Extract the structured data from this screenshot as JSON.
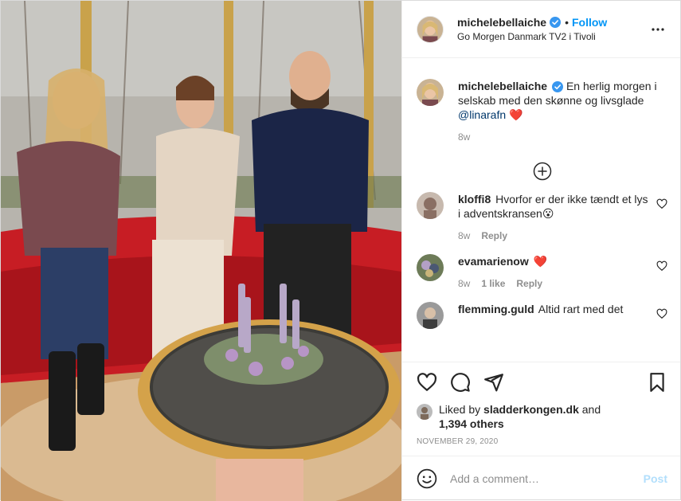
{
  "photo": {
    "alt": "",
    "colors": {
      "sofa": "#c71d24",
      "table_rim": "#d4a24a",
      "floor": "#c99b68"
    }
  },
  "header": {
    "username": "michelebellaiche",
    "separator": "•",
    "follow_label": "Follow",
    "location": "Go Morgen Danmark TV2 i Tivoli"
  },
  "caption": {
    "username": "michelebellaiche",
    "text": " En herlig morgen i selskab med den skønne og livsglade ",
    "mention": "@linarafn",
    "emoji": "❤️",
    "time": "8w"
  },
  "comments": [
    {
      "username": "kloffi8",
      "text": " Hvorfor er der ikke tændt et lys i adventskransen",
      "emoji": "😮",
      "time": "8w",
      "reply": "Reply",
      "likes": ""
    },
    {
      "username": "evamarienow",
      "text": " ",
      "emoji": "❤️",
      "time": "8w",
      "likes": "1 like",
      "reply": "Reply"
    },
    {
      "username": "flemming.guld",
      "text": " Altid rart med det",
      "emoji": "",
      "time": "",
      "reply": "",
      "likes": ""
    }
  ],
  "likes": {
    "prefix": "Liked by ",
    "user": "sladderkongen.dk",
    "middle": " and",
    "count": "1,394 others"
  },
  "date": "November 29, 2020",
  "add_comment": {
    "placeholder": "Add a comment…",
    "post_label": "Post"
  },
  "icons": {
    "verified": "verified-badge-icon",
    "more": "more-options-icon",
    "load_more": "plus-circle-icon",
    "like": "heart-icon",
    "comment": "comment-icon",
    "share": "paper-plane-icon",
    "save": "bookmark-icon",
    "emoji": "smiley-icon"
  },
  "colors": {
    "link": "#0095f6",
    "post_disabled": "#b2dffc",
    "heart_red": "#ed4956"
  }
}
